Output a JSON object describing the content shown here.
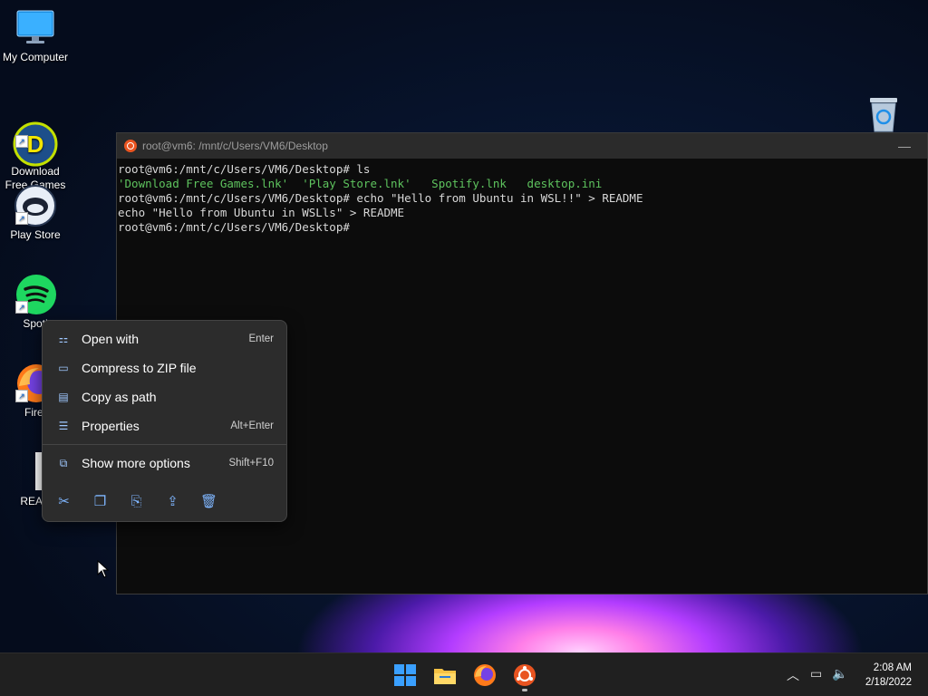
{
  "desktop": {
    "icons": [
      {
        "label": "My Computer"
      },
      {
        "label": "Download\nFree Games"
      },
      {
        "label": "Play Store"
      },
      {
        "label": "Spoti"
      },
      {
        "label": "Firef"
      },
      {
        "label": "READ"
      }
    ]
  },
  "terminal": {
    "title": "root@vm6: /mnt/c/Users/VM6/Desktop",
    "lines": {
      "l1": "root@vm6:/mnt/c/Users/VM6/Desktop# ls",
      "l2": "'Download Free Games.lnk'  'Play Store.lnk'   Spotify.lnk   desktop.ini",
      "l3": "root@vm6:/mnt/c/Users/VM6/Desktop# echo \"Hello from Ubuntu in WSL!!\" > README",
      "l4": "echo \"Hello from Ubuntu in WSLls\" > README",
      "l5": "root@vm6:/mnt/c/Users/VM6/Desktop#"
    }
  },
  "context_menu": {
    "items": [
      {
        "label": "Open with",
        "shortcut": "Enter"
      },
      {
        "label": "Compress to ZIP file",
        "shortcut": ""
      },
      {
        "label": "Copy as path",
        "shortcut": ""
      },
      {
        "label": "Properties",
        "shortcut": "Alt+Enter"
      },
      {
        "label": "Show more options",
        "shortcut": "Shift+F10"
      }
    ],
    "actions": [
      "cut-icon",
      "copy-icon",
      "rename-icon",
      "share-icon",
      "delete-icon"
    ]
  },
  "taskbar": {
    "time": "2:08 AM",
    "date": "2/18/2022"
  },
  "colors": {
    "terminal_green": "#5ec35e",
    "ubuntu_orange": "#e95420",
    "spotify_green": "#1ed760"
  }
}
